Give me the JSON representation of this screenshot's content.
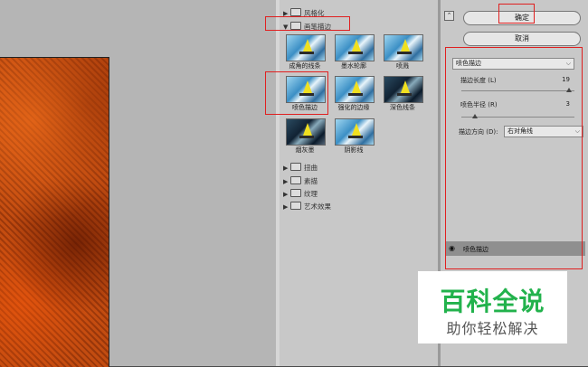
{
  "gallery": {
    "categories_top": [
      {
        "label": "风格化",
        "expanded": false
      },
      {
        "label": "画笔描边",
        "expanded": true
      }
    ],
    "thumbnails": [
      {
        "label": "成角的线条"
      },
      {
        "label": "墨水轮廓"
      },
      {
        "label": "喷溅"
      },
      {
        "label": "喷色描边"
      },
      {
        "label": "强化的边缘"
      },
      {
        "label": "深色线条"
      },
      {
        "label": "烟灰墨"
      },
      {
        "label": "阴影线"
      }
    ],
    "categories_bottom": [
      {
        "label": "扭曲"
      },
      {
        "label": "素描"
      },
      {
        "label": "纹理"
      },
      {
        "label": "艺术效果"
      }
    ]
  },
  "buttons": {
    "ok": "确定",
    "cancel": "取消",
    "collapse": "⌃"
  },
  "settings": {
    "filter_select": "喷色描边",
    "stroke_length": {
      "label": "描边长度 (L)",
      "value": "19",
      "fraction": 0.95
    },
    "spray_radius": {
      "label": "喷色半径 (R)",
      "value": "3",
      "fraction": 0.12
    },
    "stroke_direction": {
      "label": "描边方向 (D):",
      "value": "右对角线"
    }
  },
  "layer": {
    "label": "喷色描边"
  },
  "watermark": {
    "title": "百科全说",
    "subtitle": "助你轻松解决"
  }
}
